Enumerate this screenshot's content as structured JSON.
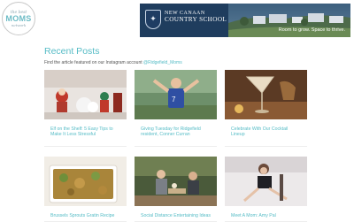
{
  "logo": {
    "line1": "the best",
    "line2": "MOMS",
    "line3": "network"
  },
  "banner": {
    "school_top": "NEW CANAAN",
    "school_name": "COUNTRY SCHOOL",
    "tagline": "Room to grow. Space to thrive.",
    "crest_icon": "shield-crest-icon"
  },
  "section": {
    "heading": "Recent Posts",
    "intro": "Find the article featured on our Instagram account ",
    "intro_link": "@Ridgefield_Moms"
  },
  "posts": [
    {
      "title": "Elf on the Shelf: 5 Easy Tips to Make It Less Stressful"
    },
    {
      "title": "Giving Tuesday for Ridgefield resident, Conner Curran"
    },
    {
      "title": "Celebrate With Our Cocktail Lineup"
    },
    {
      "title": "Brussels Sprouts Gratin Recipe"
    },
    {
      "title": "Social Distance Entertaining Ideas"
    },
    {
      "title": "Meet A Mom: Amy Pal"
    }
  ],
  "colors": {
    "accent": "#56bcc6",
    "banner": "#2a4a66"
  }
}
